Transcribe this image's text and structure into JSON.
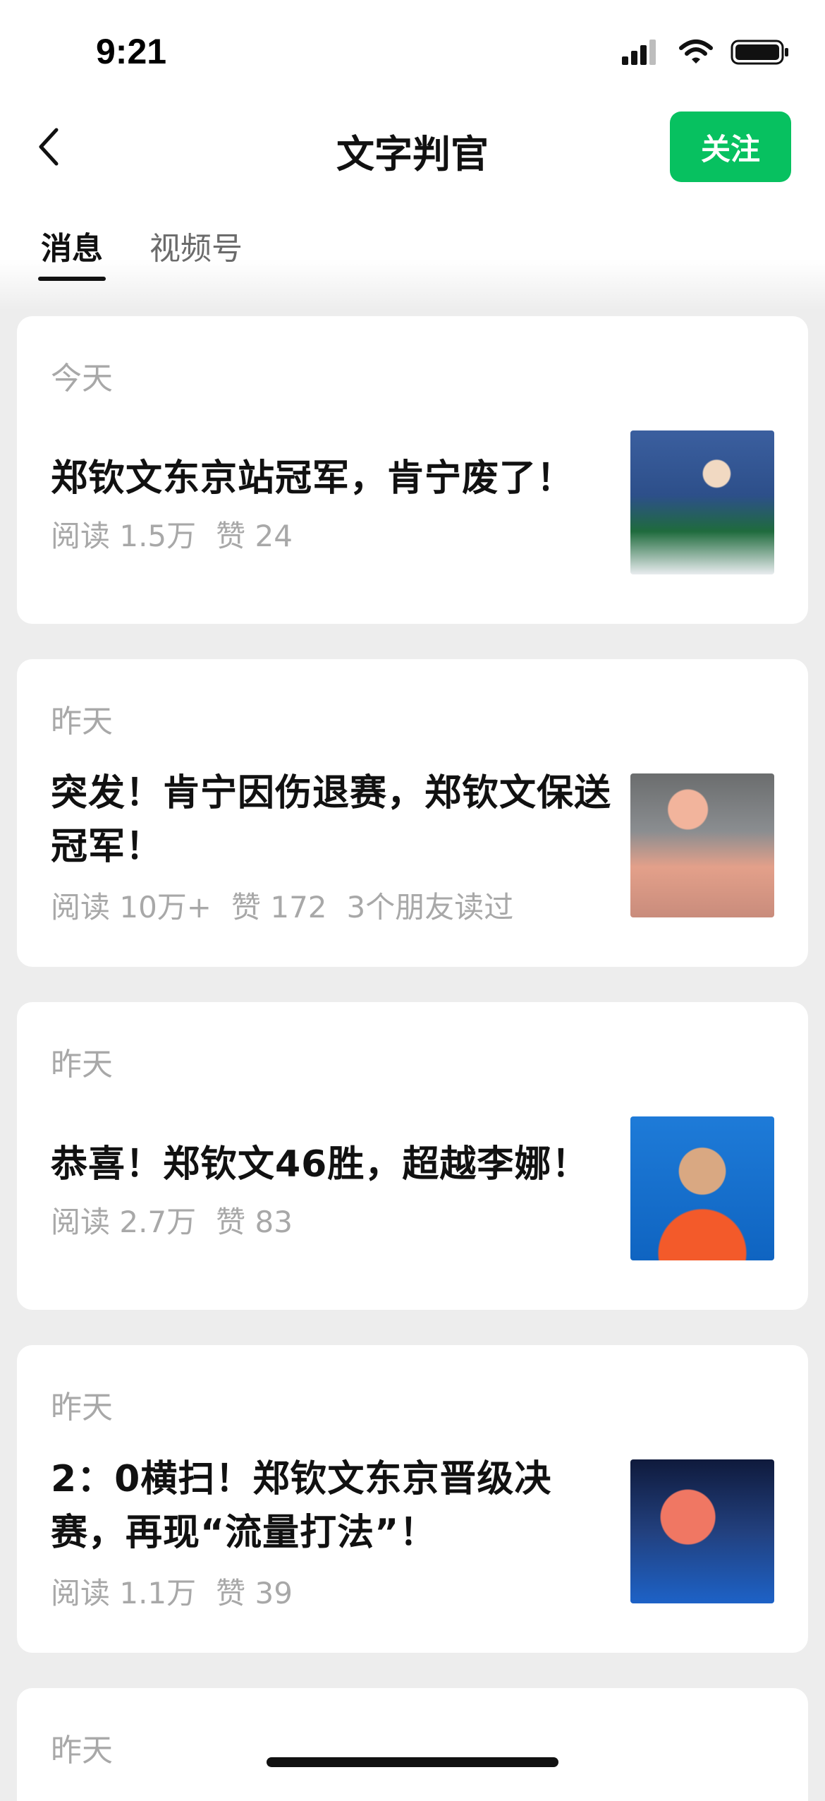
{
  "status_bar": {
    "time": "9:21",
    "icons": [
      "signal-icon",
      "wifi-icon",
      "battery-icon"
    ]
  },
  "nav": {
    "back_icon": "chevron-left-icon",
    "title": "文字判官",
    "follow_label": "关注"
  },
  "tabs": [
    {
      "label": "消息",
      "active": true
    },
    {
      "label": "视频号",
      "active": false
    }
  ],
  "articles": [
    {
      "date": "今天",
      "title": "郑钦文东京站冠军，肯宁废了！",
      "meta": [
        "阅读 1.5万",
        "赞 24"
      ]
    },
    {
      "date": "昨天",
      "title": "突发！肯宁因伤退赛，郑钦文保送冠军！",
      "meta": [
        "阅读 10万+",
        "赞 172",
        "3个朋友读过"
      ]
    },
    {
      "date": "昨天",
      "title": "恭喜！郑钦文46胜，超越李娜！",
      "meta": [
        "阅读 2.7万",
        "赞 83"
      ]
    },
    {
      "date": "昨天",
      "title": "2：0横扫！郑钦文东京晋级决赛，再现“流量打法”！",
      "meta": [
        "阅读 1.1万",
        "赞 39"
      ]
    },
    {
      "date": "昨天"
    }
  ],
  "colors": {
    "accent_green": "#07c160",
    "background": "#ededed",
    "card": "#ffffff",
    "muted_text": "#a8a8a8"
  }
}
